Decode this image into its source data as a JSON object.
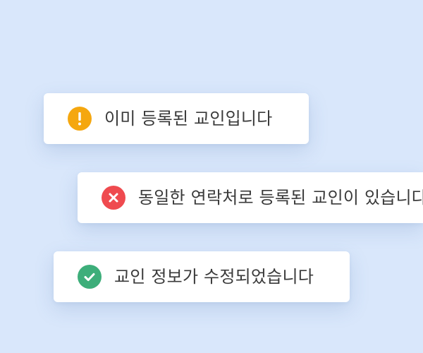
{
  "toasts": [
    {
      "type": "warning",
      "icon": "exclamation-icon",
      "color": "#f5a70f",
      "message": "이미 등록된 교인입니다"
    },
    {
      "type": "error",
      "icon": "close-icon",
      "color": "#ef4a4f",
      "message": "동일한 연락처로 등록된 교인이 있습니다"
    },
    {
      "type": "success",
      "icon": "check-icon",
      "color": "#3dae7a",
      "message": "교인 정보가 수정되었습니다"
    }
  ],
  "colors": {
    "background": "#d9e7fb",
    "text": "#3a3a3a"
  }
}
